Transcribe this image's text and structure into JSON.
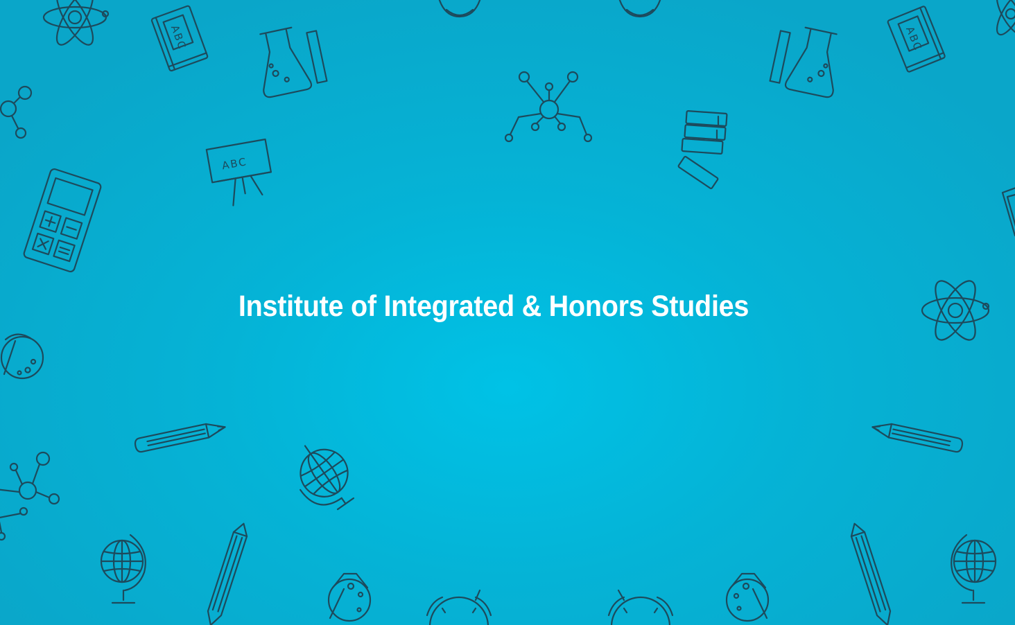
{
  "banner": {
    "title": "Institute of Integrated & Honors Studies",
    "accent_color": "#00c2e6",
    "text_color": "#ffffff",
    "line_color": "#1d4a5c"
  },
  "icons": {
    "board_text": "ABC",
    "book_text": "ABC"
  }
}
